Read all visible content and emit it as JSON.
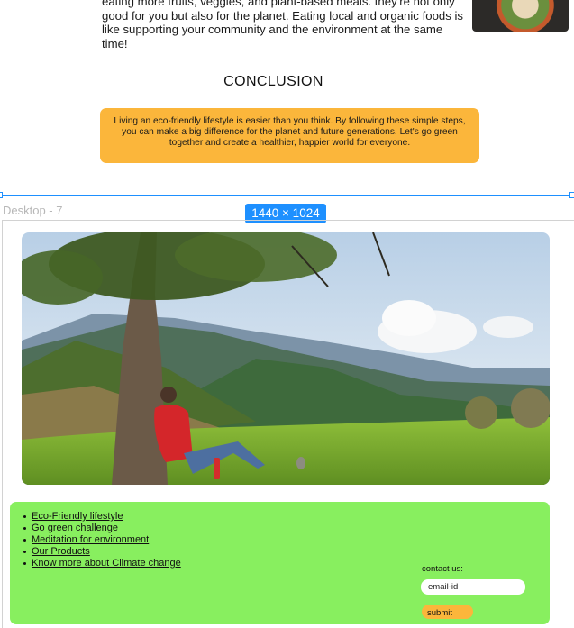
{
  "intro": {
    "lines": [
      "eating more fruits, veggies, and plant-based meals. they're not only",
      "good for you but also for the planet. Eating local and organic foods is",
      "like supporting your community and the environment at the same time!"
    ]
  },
  "conclusion": {
    "title": "CONCLUSION",
    "text": "Living an eco-friendly lifestyle is easier than you think. By following these simple steps, you can make a big difference for the planet and future generations. Let's go green together and create a healthier, happier world for everyone."
  },
  "canvas": {
    "frame_name": "Desktop - 7",
    "frame_size": "1440 × 1024"
  },
  "footer": {
    "links": [
      "Eco-Friendly lifestyle",
      "Go green challenge",
      "Meditation for environment",
      "Our Products",
      "Know more about Climate change"
    ],
    "contact_label": "contact us:",
    "email_placeholder": "email-id",
    "submit_label": "submit"
  },
  "colors": {
    "accent_orange": "#fbb63b",
    "footer_green": "#88ef5f",
    "selection_blue": "#1e90ff"
  }
}
